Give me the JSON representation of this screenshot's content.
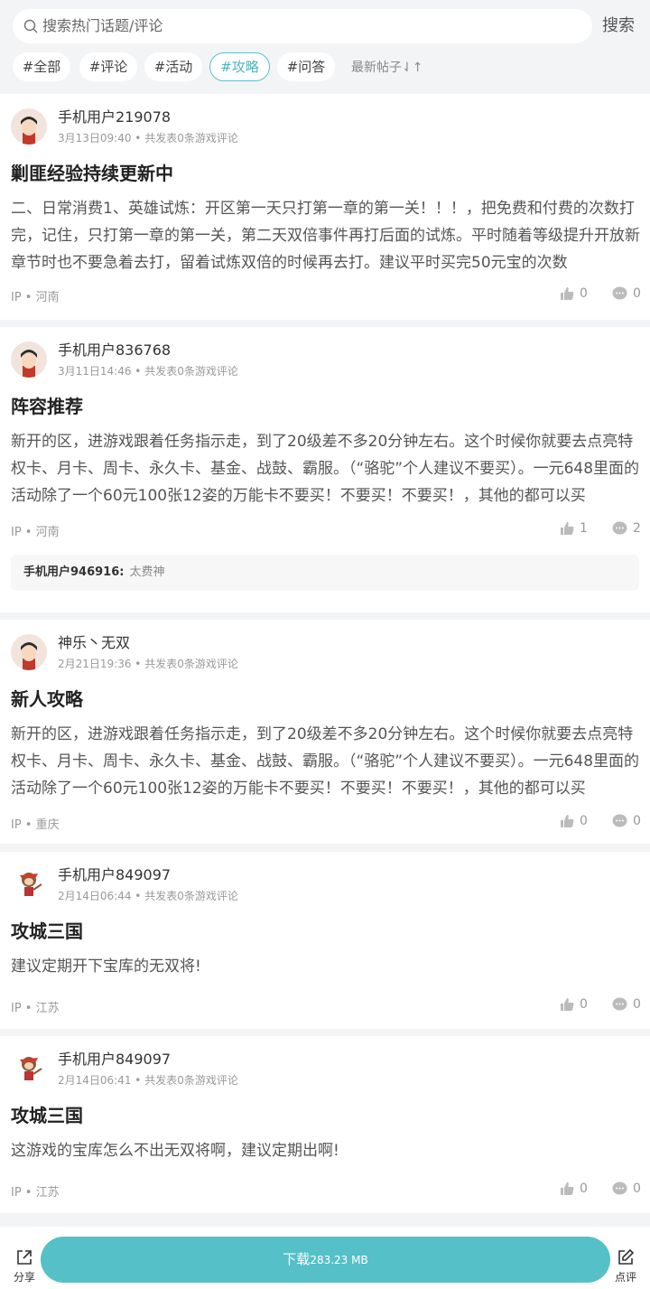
{
  "search": {
    "placeholder": "搜索热门话题/评论",
    "button": "搜索"
  },
  "tags": [
    {
      "label": "#全部",
      "active": false
    },
    {
      "label": "#评论",
      "active": false
    },
    {
      "label": "#活动",
      "active": false
    },
    {
      "label": "#攻略",
      "active": true
    },
    {
      "label": "#问答",
      "active": false
    }
  ],
  "sort_label": "最新帖子⇃↑",
  "posts": [
    {
      "user": "手机用户219078",
      "meta": "3月13日09:40 • 共发表0条游戏评论",
      "title": "剿匪经验持续更新中",
      "body": "二、日常消费1、英雄试炼：开区第一天只打第一章的第一关！！！，把免费和付费的次数打完，记住，只打第一章的第一关，第二天双倍事件再打后面的试炼。平时随着等级提升开放新章节时也不要急着去打，留着试炼双倍的时候再去打。建议平时买完50元宝的次数",
      "ip": "IP • 河南",
      "likes": "0",
      "comments": "0"
    },
    {
      "user": "手机用户836768",
      "meta": "3月11日14:46 • 共发表0条游戏评论",
      "title": "阵容推荐",
      "body": "新开的区，进游戏跟着任务指示走，到了20级差不多20分钟左右。这个时候你就要去点亮特权卡、月卡、周卡、永久卡、基金、战鼓、霸服。（“骆驼”个人建议不要买）。一元648里面的活动除了一个60元100张12姿的万能卡不要买！不要买！不要买！，其他的都可以买",
      "ip": "IP • 河南",
      "likes": "1",
      "comments": "2",
      "reply": {
        "user": "手机用户946916:",
        "text": "太费神"
      }
    },
    {
      "user": "神乐丶无双",
      "meta": "2月21日19:36 • 共发表0条游戏评论",
      "title": "新人攻略",
      "body": "新开的区，进游戏跟着任务指示走，到了20级差不多20分钟左右。这个时候你就要去点亮特权卡、月卡、周卡、永久卡、基金、战鼓、霸服。（“骆驼”个人建议不要买）。一元648里面的活动除了一个60元100张12姿的万能卡不要买！不要买！不要买！，其他的都可以买",
      "ip": "IP • 重庆",
      "likes": "0",
      "comments": "0"
    },
    {
      "user": "手机用户849097",
      "meta": "2月14日06:44 • 共发表0条游戏评论",
      "title": "攻城三国",
      "body": "建议定期开下宝库的无双将!",
      "ip": "IP • 江苏",
      "likes": "0",
      "comments": "0"
    },
    {
      "user": "手机用户849097",
      "meta": "2月14日06:41 • 共发表0条游戏评论",
      "title": "攻城三国",
      "body": "这游戏的宝库怎么不出无双将啊，建议定期出啊!",
      "ip": "IP • 江苏",
      "likes": "0",
      "comments": "0"
    }
  ],
  "bottom": {
    "share": "分享",
    "download": "下载",
    "download_size": "283.23 MB",
    "review": "点评"
  },
  "colors": {
    "accent": "#55c0c8",
    "tag_active": "#4fb3bd"
  }
}
